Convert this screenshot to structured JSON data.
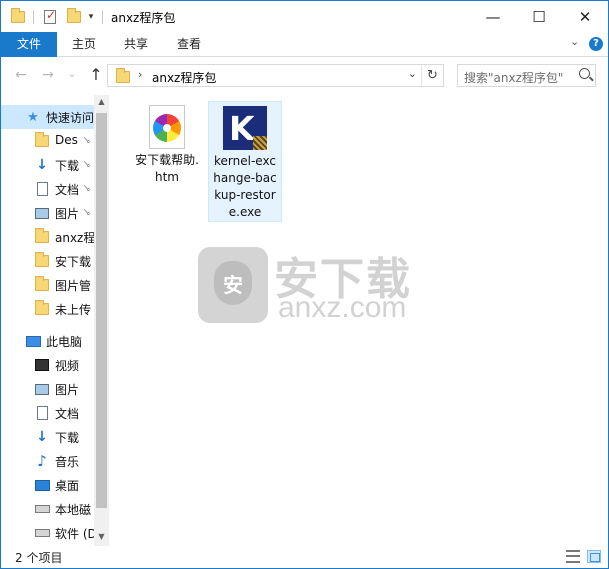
{
  "window": {
    "title": "anxz程序包",
    "controls": {
      "minimize": "—",
      "maximize": "☐",
      "close": "✕"
    }
  },
  "ribbon": {
    "tabs": [
      "文件",
      "主页",
      "共享",
      "查看"
    ],
    "expand_glyph": "⌄",
    "help_glyph": "?"
  },
  "nav": {
    "back_glyph": "←",
    "forward_glyph": "→",
    "recent_glyph": "⌄",
    "up_glyph": "↑"
  },
  "address": {
    "chevron": "›",
    "path": "anxz程序包",
    "dropdown_glyph": "⌄",
    "refresh_glyph": "↻"
  },
  "search": {
    "placeholder": "搜索\"anxz程序包\""
  },
  "sidebar": {
    "items": [
      {
        "label": "快速访问",
        "icon": "star-icon",
        "pinned": false,
        "selected": true
      },
      {
        "label": "Des",
        "icon": "folder-icon",
        "pinned": true
      },
      {
        "label": "下载",
        "icon": "download-icon",
        "pinned": true
      },
      {
        "label": "文档",
        "icon": "document-icon",
        "pinned": true
      },
      {
        "label": "图片",
        "icon": "picture-icon",
        "pinned": true
      },
      {
        "label": "anxz程",
        "icon": "folder-icon",
        "pinned": false
      },
      {
        "label": "安下载",
        "icon": "folder-icon",
        "pinned": false
      },
      {
        "label": "图片管",
        "icon": "folder-icon",
        "pinned": false
      },
      {
        "label": "未上传",
        "icon": "folder-icon",
        "pinned": false
      },
      {
        "label": "此电脑",
        "icon": "computer-icon",
        "pinned": false
      },
      {
        "label": "视频",
        "icon": "video-icon",
        "pinned": false
      },
      {
        "label": "图片",
        "icon": "picture-icon",
        "pinned": false
      },
      {
        "label": "文档",
        "icon": "document-icon",
        "pinned": false
      },
      {
        "label": "下载",
        "icon": "download-icon",
        "pinned": false
      },
      {
        "label": "音乐",
        "icon": "music-icon",
        "pinned": false
      },
      {
        "label": "桌面",
        "icon": "desktop-icon",
        "pinned": false
      },
      {
        "label": "本地磁",
        "icon": "drive-icon",
        "pinned": false
      },
      {
        "label": "软件 (D",
        "icon": "drive-icon",
        "pinned": false
      }
    ],
    "pin_glyph": "📌"
  },
  "files": [
    {
      "name": "安下载帮助.htm",
      "icon": "htm-file-icon",
      "selected": false
    },
    {
      "name": "kernel-exchange-backup-restore.exe",
      "icon": "kernel-exe-icon",
      "selected": true,
      "icon_letter": "K"
    }
  ],
  "watermark": {
    "shield_char": "安",
    "text_large": "安下载",
    "text_small": "anxz.com"
  },
  "status": {
    "item_count": "2 个项目"
  },
  "colors": {
    "accent": "#1979ca",
    "selection": "#cce8ff",
    "watermark": "#d2d2d2"
  }
}
